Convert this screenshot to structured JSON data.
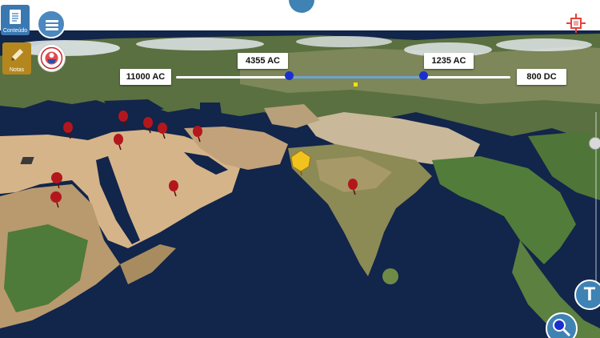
{
  "toolbar": {
    "contents_label": "Conteúdo",
    "notes_label": "Notas"
  },
  "timeline": {
    "range_start": "11000 AC",
    "range_end": "800 DC",
    "handle_1": "4355 AC",
    "handle_2": "1235 AC"
  },
  "icons": {
    "contents": "document-icon",
    "notes": "pencil-icon",
    "menu": "menu-icon",
    "logo": "logo-emblem",
    "target": "target-icon",
    "text": "text-icon",
    "search": "search-icon"
  },
  "text_button": "T",
  "colors": {
    "accent": "#3f82b4",
    "notes": "#b4871e",
    "handle": "#1a2fd0",
    "pin": "#b3171d",
    "highlight_pin": "#f2c21e",
    "timeline_marker": "#f2e200"
  }
}
